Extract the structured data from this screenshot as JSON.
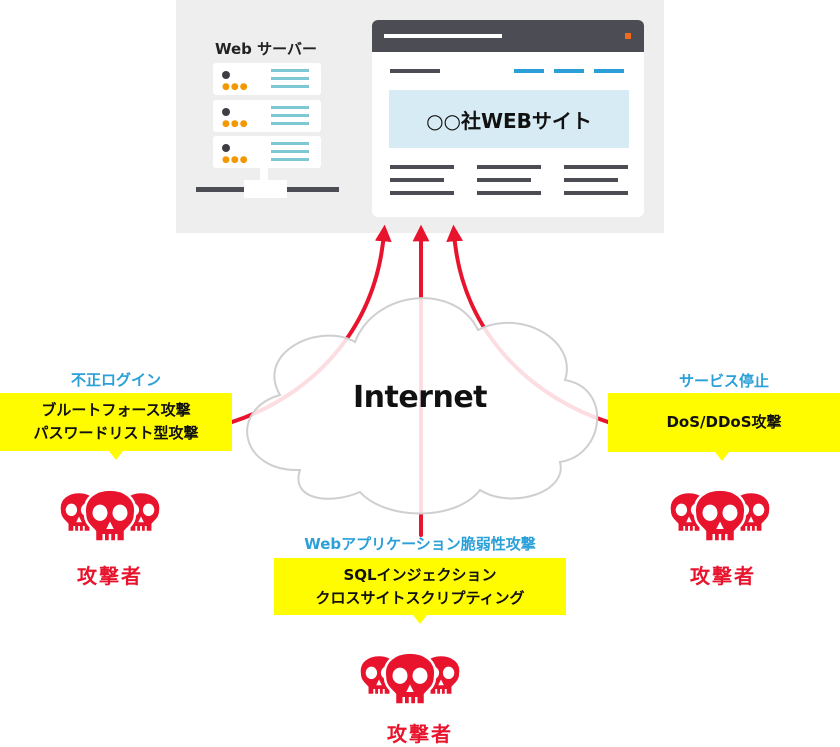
{
  "server": {
    "title": "Web サーバー"
  },
  "website": {
    "title": "○○社WEBサイト"
  },
  "cloud": {
    "label": "Internet"
  },
  "attacks": {
    "left": {
      "category": "不正ログイン",
      "items": [
        "ブルートフォース攻撃",
        "パスワードリスト型攻撃"
      ],
      "attacker": "攻撃者"
    },
    "center": {
      "category": "Webアプリケーション脆弱性攻撃",
      "items": [
        "SQLインジェクション",
        "クロスサイトスクリプティング"
      ],
      "attacker": "攻撃者"
    },
    "right": {
      "category": "サービス停止",
      "items": [
        "DoS/DDoS攻撃"
      ],
      "attacker": "攻撃者"
    }
  },
  "colors": {
    "arrow": "#e8132c",
    "highlight": "#fffc00",
    "category_text": "#2a9fd8",
    "attacker": "#e8132c",
    "server_panel": "#eeeeee",
    "browser_bar": "#4c4c55"
  },
  "icons": {
    "attacker": "skull-group-icon",
    "server": "server-rack-icon",
    "browser": "browser-window-icon",
    "cloud": "cloud-icon"
  }
}
